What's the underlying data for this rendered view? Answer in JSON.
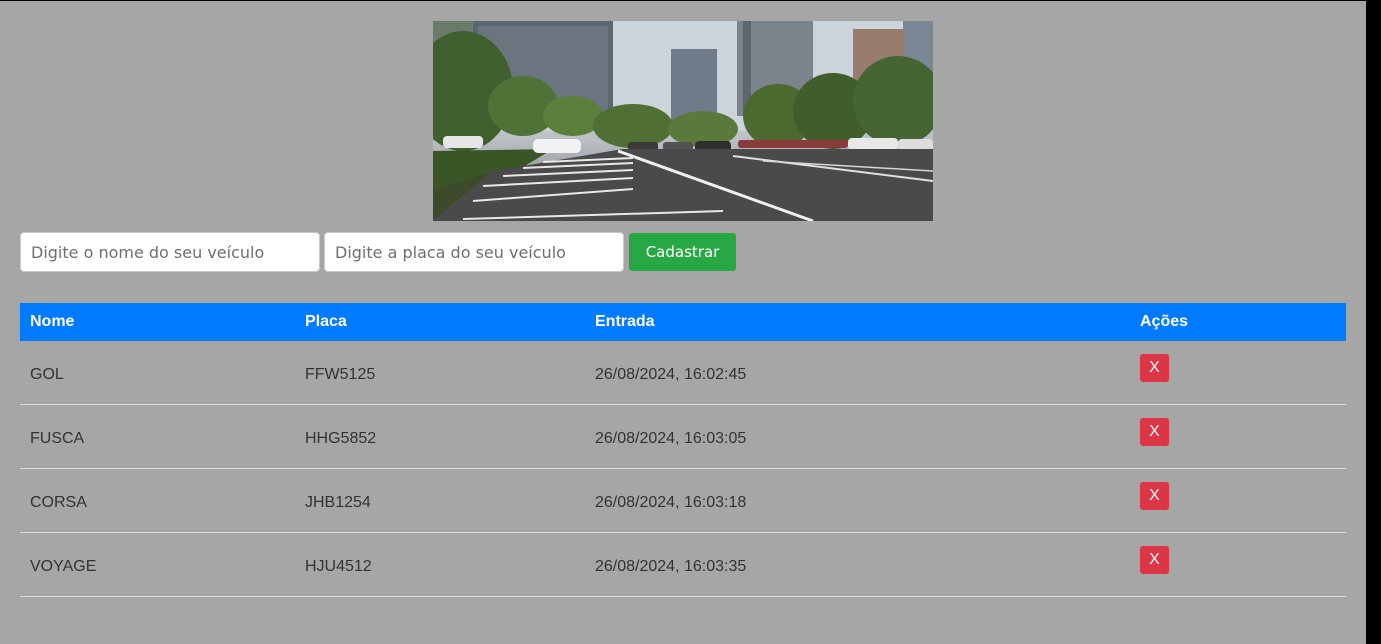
{
  "banner": {
    "alt": "parking lot"
  },
  "form": {
    "name_placeholder": "Digite o nome do seu veículo",
    "plate_placeholder": "Digite a placa do seu veículo",
    "submit_label": "Cadastrar"
  },
  "table": {
    "headers": {
      "name": "Nome",
      "plate": "Placa",
      "entry": "Entrada",
      "actions": "Ações"
    },
    "rows": [
      {
        "name": "GOL",
        "plate": "FFW5125",
        "entry": "26/08/2024, 16:02:45",
        "delete_label": "X"
      },
      {
        "name": "FUSCA",
        "plate": "HHG5852",
        "entry": "26/08/2024, 16:03:05",
        "delete_label": "X"
      },
      {
        "name": "CORSA",
        "plate": "JHB1254",
        "entry": "26/08/2024, 16:03:18",
        "delete_label": "X"
      },
      {
        "name": "VOYAGE",
        "plate": "HJU4512",
        "entry": "26/08/2024, 16:03:35",
        "delete_label": "X"
      }
    ]
  },
  "colors": {
    "page_background": "#a6a6a6",
    "header_blue": "#007bff",
    "submit_green": "#28a745",
    "delete_red": "#dc3545"
  }
}
